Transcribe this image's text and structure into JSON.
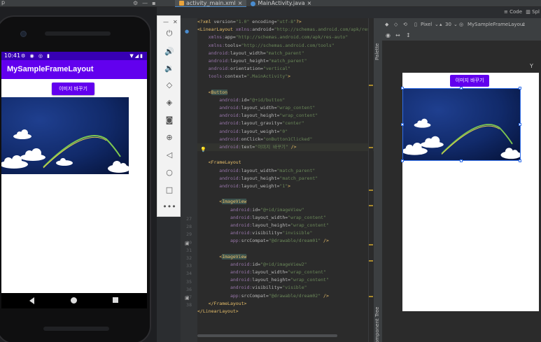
{
  "ide": {
    "title_fragment": "p",
    "tabs": [
      {
        "label": "activity_main.xml",
        "active": true
      },
      {
        "label": "MainActivity.java",
        "active": false
      }
    ],
    "right_header": "Code",
    "right_header_2": "Spl"
  },
  "emulator": {
    "status_time": "10:41",
    "app_title": "MySampleFrameLayout",
    "button_label": "이미지 바꾸기",
    "toolbar_tools": [
      "power-icon",
      "volume-up-icon",
      "volume-down-icon",
      "rotate-left-icon",
      "rotate-right-icon",
      "camera-icon",
      "zoom-icon",
      "back-icon",
      "home-icon",
      "overview-icon",
      "more-icon"
    ]
  },
  "editor": {
    "line_numbers_visible": [
      "27",
      "28",
      "29",
      "30",
      "31",
      "32",
      "33",
      "34",
      "35",
      "36",
      "37",
      "38"
    ],
    "lines": [
      [
        [
          "punc",
          "<?"
        ],
        [
          "tag",
          "xml"
        ],
        [
          "attr",
          " version="
        ],
        [
          "val",
          "\"1.0\""
        ],
        [
          "attr",
          " encoding="
        ],
        [
          "val",
          "\"utf-8\""
        ],
        [
          "punc",
          "?>"
        ]
      ],
      [
        [
          "punc",
          "<"
        ],
        [
          "tag",
          "LinearLayout"
        ],
        [
          "ns",
          " xmlns:"
        ],
        [
          "attr",
          "android="
        ],
        [
          "val",
          "\"http://schemas.android.com/apk/res"
        ]
      ],
      [
        [
          "ns",
          "    xmlns:"
        ],
        [
          "attr",
          "app="
        ],
        [
          "val",
          "\"http://schemas.android.com/apk/res-auto\""
        ]
      ],
      [
        [
          "ns",
          "    xmlns:"
        ],
        [
          "attr",
          "tools="
        ],
        [
          "val",
          "\"http://schemas.android.com/tools\""
        ]
      ],
      [
        [
          "ns",
          "    android:"
        ],
        [
          "attr",
          "layout_width="
        ],
        [
          "val",
          "\"match_parent\""
        ]
      ],
      [
        [
          "ns",
          "    android:"
        ],
        [
          "attr",
          "layout_height="
        ],
        [
          "val",
          "\"match_parent\""
        ]
      ],
      [
        [
          "ns",
          "    android:"
        ],
        [
          "attr",
          "orientation="
        ],
        [
          "val",
          "\"vertical\""
        ]
      ],
      [
        [
          "ns",
          "    tools:"
        ],
        [
          "attr",
          "context="
        ],
        [
          "val",
          "\".MainActivity\""
        ],
        [
          "punc",
          ">"
        ]
      ],
      [],
      [
        [
          "punc",
          "    <"
        ],
        [
          "tag",
          "Button"
        ]
      ],
      [
        [
          "ns",
          "        android:"
        ],
        [
          "attr",
          "id="
        ],
        [
          "val",
          "\"@+id/button\""
        ]
      ],
      [
        [
          "ns",
          "        android:"
        ],
        [
          "attr",
          "layout_width="
        ],
        [
          "val",
          "\"wrap_content\""
        ]
      ],
      [
        [
          "ns",
          "        android:"
        ],
        [
          "attr",
          "layout_height="
        ],
        [
          "val",
          "\"wrap_content\""
        ]
      ],
      [
        [
          "ns",
          "        android:"
        ],
        [
          "attr",
          "layout_gravity="
        ],
        [
          "val",
          "\"center\""
        ]
      ],
      [
        [
          "ns",
          "        android:"
        ],
        [
          "attr",
          "layout_weight="
        ],
        [
          "val",
          "\"0\""
        ]
      ],
      [
        [
          "ns",
          "        android:"
        ],
        [
          "attr",
          "onClick="
        ],
        [
          "val",
          "\"onButton1Clicked\""
        ]
      ],
      [
        [
          "ns",
          "        android:"
        ],
        [
          "attr",
          "text="
        ],
        [
          "val",
          "\"이미지 바꾸기\""
        ],
        [
          "punc",
          " />"
        ]
      ],
      [],
      [
        [
          "punc",
          "    <"
        ],
        [
          "tag",
          "FrameLayout"
        ]
      ],
      [
        [
          "ns",
          "        android:"
        ],
        [
          "attr",
          "layout_width="
        ],
        [
          "val",
          "\"match_parent\""
        ]
      ],
      [
        [
          "ns",
          "        android:"
        ],
        [
          "attr",
          "layout_height="
        ],
        [
          "val",
          "\"match_parent\""
        ]
      ],
      [
        [
          "ns",
          "        android:"
        ],
        [
          "attr",
          "layout_weight="
        ],
        [
          "val",
          "\"1\""
        ],
        [
          "punc",
          ">"
        ]
      ],
      [],
      [
        [
          "punc",
          "        <"
        ],
        [
          "tag",
          "ImageView"
        ]
      ],
      [
        [
          "ns",
          "            android:"
        ],
        [
          "attr",
          "id="
        ],
        [
          "val",
          "\"@+id/imageView\""
        ]
      ],
      [
        [
          "ns",
          "            android:"
        ],
        [
          "attr",
          "layout_width="
        ],
        [
          "val",
          "\"wrap_content\""
        ]
      ],
      [
        [
          "ns",
          "            android:"
        ],
        [
          "attr",
          "layout_height="
        ],
        [
          "val",
          "\"wrap_content\""
        ]
      ],
      [
        [
          "ns",
          "            android:"
        ],
        [
          "attr",
          "visibility="
        ],
        [
          "val",
          "\"invisible\""
        ]
      ],
      [
        [
          "ns",
          "            app:"
        ],
        [
          "attr",
          "srcCompat="
        ],
        [
          "val",
          "\"@drawable/dream01\""
        ],
        [
          "punc",
          " />"
        ]
      ],
      [],
      [
        [
          "punc",
          "        <"
        ],
        [
          "tag",
          "ImageView"
        ]
      ],
      [
        [
          "ns",
          "            android:"
        ],
        [
          "attr",
          "id="
        ],
        [
          "val",
          "\"@+id/imageView2\""
        ]
      ],
      [
        [
          "ns",
          "            android:"
        ],
        [
          "attr",
          "layout_width="
        ],
        [
          "val",
          "\"wrap_content\""
        ]
      ],
      [
        [
          "ns",
          "            android:"
        ],
        [
          "attr",
          "layout_height="
        ],
        [
          "val",
          "\"wrap_content\""
        ]
      ],
      [
        [
          "ns",
          "            android:"
        ],
        [
          "attr",
          "visibility="
        ],
        [
          "val",
          "\"visible\""
        ]
      ],
      [
        [
          "ns",
          "            app:"
        ],
        [
          "attr",
          "srcCompat="
        ],
        [
          "val",
          "\"@drawable/dream02\""
        ],
        [
          "punc",
          " />"
        ]
      ],
      [
        [
          "punc",
          "    </"
        ],
        [
          "tag",
          "FrameLayout"
        ],
        [
          "punc",
          ">"
        ]
      ],
      [
        [
          "punc",
          "</"
        ],
        [
          "tag",
          "LinearLayout"
        ],
        [
          "punc",
          ">"
        ]
      ]
    ]
  },
  "design": {
    "device": "Pixel",
    "api": "30",
    "theme": "MySampleFrameLayout",
    "button_label": "이미지 바꾸기",
    "palette_label": "Palette",
    "component_tree_label": "Component Tree"
  },
  "colors": {
    "primary": "#6200ee",
    "primary_dark": "#3700b3",
    "selection": "#2f6de8"
  }
}
